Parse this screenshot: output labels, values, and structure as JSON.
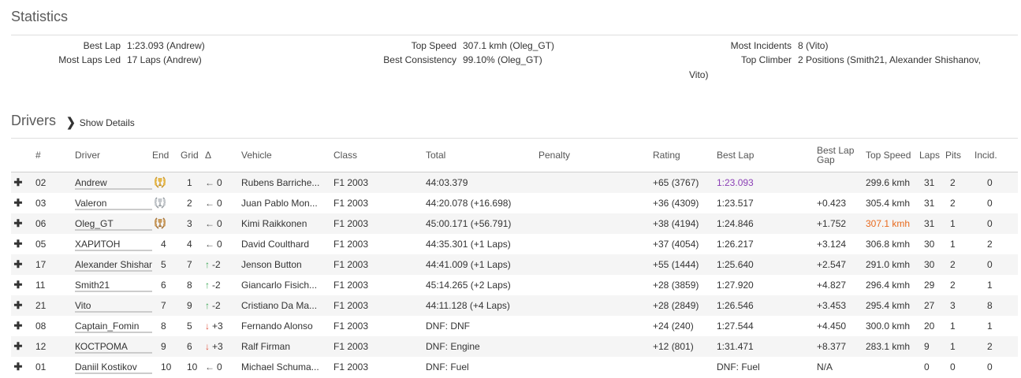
{
  "statistics": {
    "title": "Statistics",
    "col1": [
      {
        "label": "Best Lap",
        "value": "1:23.093 (Andrew)"
      },
      {
        "label": "Most Laps Led",
        "value": "17 Laps (Andrew)"
      }
    ],
    "col2": [
      {
        "label": "Top Speed",
        "value": "307.1 kmh (Oleg_GT)"
      },
      {
        "label": "Best Consistency",
        "value": "99.10% (Oleg_GT)"
      }
    ],
    "col3": [
      {
        "label": "Most Incidents",
        "value": "8 (Vito)"
      },
      {
        "label": "Top Climber",
        "value": "2 Positions (Smith21, Alexander Shishanov,"
      }
    ],
    "col3_wrap": "Vito)"
  },
  "drivers": {
    "title": "Drivers",
    "show_details": "Show Details",
    "columns": {
      "num": "#",
      "driver": "Driver",
      "end": "End",
      "grid": "Grid",
      "delta": "Δ",
      "vehicle": "Vehicle",
      "class": "Class",
      "total": "Total",
      "penalty": "Penalty",
      "rating": "Rating",
      "best_lap": "Best Lap",
      "best_lap_gap": "Best Lap Gap",
      "top_speed": "Top Speed",
      "laps": "Laps",
      "pits": "Pits",
      "incid": "Incid."
    },
    "rows": [
      {
        "num": "02",
        "driver": "Andrew",
        "bar": 0.85,
        "end": "",
        "trophy": "gold",
        "grid": "1",
        "dir": "left",
        "delta": "0",
        "vehicle": "Rubens Barriche...",
        "class": "F1 2003",
        "total": "44:03.379",
        "penalty": "",
        "rating": "+65 (3767)",
        "best_lap": "1:23.093",
        "best_lap_style": "purple",
        "gap": "",
        "top_speed": "299.6 kmh",
        "speed_style": "",
        "laps": "31",
        "pits": "2",
        "incid": "0"
      },
      {
        "num": "03",
        "driver": "Valeron",
        "bar": 1.0,
        "end": "",
        "trophy": "silver",
        "grid": "2",
        "dir": "left",
        "delta": "0",
        "vehicle": "Juan Pablo Mon...",
        "class": "F1 2003",
        "total": "44:20.078 (+16.698)",
        "penalty": "",
        "rating": "+36 (4309)",
        "best_lap": "1:23.517",
        "best_lap_style": "",
        "gap": "+0.423",
        "top_speed": "305.4 kmh",
        "speed_style": "",
        "laps": "31",
        "pits": "2",
        "incid": "0"
      },
      {
        "num": "06",
        "driver": "Oleg_GT",
        "bar": 0.96,
        "end": "",
        "trophy": "bronze",
        "grid": "3",
        "dir": "left",
        "delta": "0",
        "vehicle": "Kimi Raikkonen",
        "class": "F1 2003",
        "total": "45:00.171 (+56.791)",
        "penalty": "",
        "rating": "+38 (4194)",
        "best_lap": "1:24.846",
        "best_lap_style": "",
        "gap": "+1.752",
        "top_speed": "307.1 kmh",
        "speed_style": "orange",
        "laps": "31",
        "pits": "1",
        "incid": "0"
      },
      {
        "num": "05",
        "driver": "ХАРИТОН",
        "bar": 0.52,
        "end": "4",
        "trophy": "",
        "grid": "4",
        "dir": "left",
        "delta": "0",
        "vehicle": "David Coulthard",
        "class": "F1 2003",
        "total": "44:35.301 (+1 Laps)",
        "penalty": "",
        "rating": "+37 (4054)",
        "best_lap": "1:26.217",
        "best_lap_style": "",
        "gap": "+3.124",
        "top_speed": "306.8 kmh",
        "speed_style": "",
        "laps": "30",
        "pits": "1",
        "incid": "2"
      },
      {
        "num": "17",
        "driver": "Alexander Shishanov",
        "bar": 1.0,
        "end": "5",
        "trophy": "",
        "grid": "7",
        "dir": "up",
        "delta": "-2",
        "vehicle": "Jenson Button",
        "class": "F1 2003",
        "total": "44:41.009 (+1 Laps)",
        "penalty": "",
        "rating": "+55 (1444)",
        "best_lap": "1:25.640",
        "best_lap_style": "",
        "gap": "+2.547",
        "top_speed": "291.0 kmh",
        "speed_style": "",
        "laps": "30",
        "pits": "2",
        "incid": "0"
      },
      {
        "num": "11",
        "driver": "Smith21",
        "bar": 0.88,
        "end": "6",
        "trophy": "",
        "grid": "8",
        "dir": "up",
        "delta": "-2",
        "vehicle": "Giancarlo Fisich...",
        "class": "F1 2003",
        "total": "45:14.265 (+2 Laps)",
        "penalty": "",
        "rating": "+28 (3859)",
        "best_lap": "1:27.920",
        "best_lap_style": "",
        "gap": "+4.827",
        "top_speed": "296.4 kmh",
        "speed_style": "",
        "laps": "29",
        "pits": "2",
        "incid": "1"
      },
      {
        "num": "21",
        "driver": "Vito",
        "bar": 0.66,
        "end": "7",
        "trophy": "",
        "grid": "9",
        "dir": "up",
        "delta": "-2",
        "vehicle": "Cristiano Da Ma...",
        "class": "F1 2003",
        "total": "44:11.128 (+4 Laps)",
        "penalty": "",
        "rating": "+28 (2849)",
        "best_lap": "1:26.546",
        "best_lap_style": "",
        "gap": "+3.453",
        "top_speed": "295.4 kmh",
        "speed_style": "",
        "laps": "27",
        "pits": "3",
        "incid": "8"
      },
      {
        "num": "08",
        "driver": "Captain_Fomin",
        "bar": 0.3,
        "end": "8",
        "trophy": "",
        "grid": "5",
        "dir": "down",
        "delta": "+3",
        "vehicle": "Fernando Alonso",
        "class": "F1 2003",
        "total": "DNF: DNF",
        "penalty": "",
        "rating": "+24 (240)",
        "best_lap": "1:27.544",
        "best_lap_style": "",
        "gap": "+4.450",
        "top_speed": "300.0 kmh",
        "speed_style": "",
        "laps": "20",
        "pits": "1",
        "incid": "1"
      },
      {
        "num": "12",
        "driver": "КОСТРОМА",
        "bar": 0.3,
        "end": "9",
        "trophy": "",
        "grid": "6",
        "dir": "down",
        "delta": "+3",
        "vehicle": "Ralf Firman",
        "class": "F1 2003",
        "total": "DNF: Engine",
        "penalty": "",
        "rating": "+12 (801)",
        "best_lap": "1:31.471",
        "best_lap_style": "",
        "gap": "+8.377",
        "top_speed": "283.1 kmh",
        "speed_style": "",
        "laps": "9",
        "pits": "1",
        "incid": "2"
      },
      {
        "num": "01",
        "driver": "Daniil Kostikov",
        "bar": 0.0,
        "end": "10",
        "trophy": "",
        "grid": "10",
        "dir": "left",
        "delta": "0",
        "vehicle": "Michael Schuma...",
        "class": "F1 2003",
        "total": "DNF: Fuel",
        "penalty": "",
        "rating": "",
        "best_lap": "DNF: Fuel",
        "best_lap_style": "",
        "gap": "N/A",
        "top_speed": "",
        "speed_style": "",
        "laps": "0",
        "pits": "0",
        "incid": "0"
      }
    ]
  },
  "icons": {
    "expand": "plus-icon",
    "chevron": "chevron-right-icon",
    "trophy": "laurel-trophy-icon"
  },
  "colors": {
    "accent": "#f07b22",
    "purple": "#8b3fb5",
    "up": "#3aa655",
    "down": "#e0523d"
  }
}
